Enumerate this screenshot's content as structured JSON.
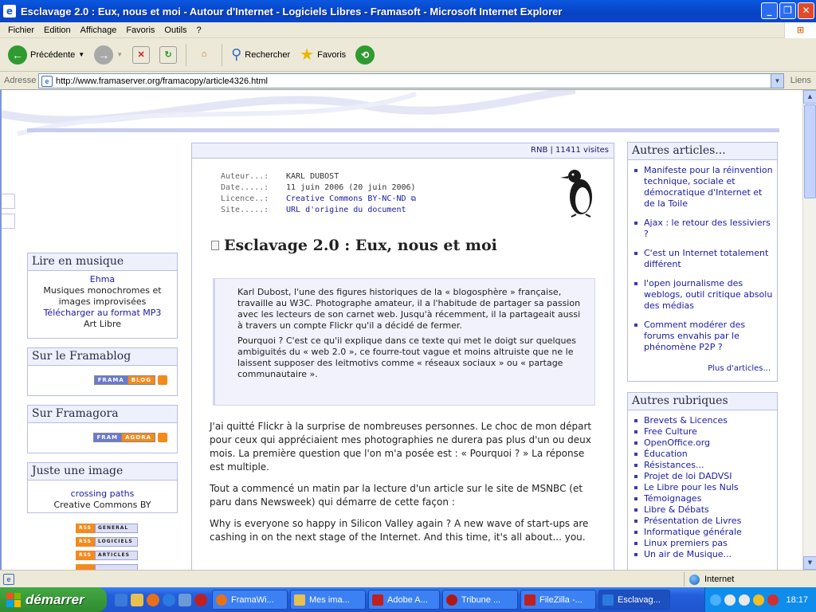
{
  "window": {
    "title": "Esclavage 2.0 : Eux, nous et moi - Autour d'Internet - Logiciels Libres - Framasoft - Microsoft Internet Explorer"
  },
  "menu": [
    "Fichier",
    "Edition",
    "Affichage",
    "Favoris",
    "Outils",
    "?"
  ],
  "toolbar": {
    "back": "Précédente",
    "search": "Rechercher",
    "favorites": "Favoris"
  },
  "address": {
    "label": "Adresse",
    "url": "http://www.framaserver.org/framacopy/article4326.html",
    "links": "Liens"
  },
  "page": {
    "stats": "RNB | 11411 visites",
    "meta": [
      {
        "label": "Auteur...:",
        "value": "KARL DUBOST"
      },
      {
        "label": "Date.....:",
        "value": "11 juin 2006 (20 juin 2006)"
      },
      {
        "label": "Licence..:",
        "value": "Creative Commons BY-NC-ND"
      },
      {
        "label": "Site.....:",
        "value": "URL d'origine du document"
      }
    ],
    "title": "Esclavage 2.0 : Eux, nous et moi",
    "chapo": [
      "Karl Dubost, l'une des figures historiques de la « blogosphère » française, travaille au W3C. Photographe amateur, il a l'habitude de partager sa passion avec les lecteurs de son carnet web. Jusqu'à récemment, il la partageait aussi à travers un compte Flickr qu'il a décidé de fermer.",
      "Pourquoi ? C'est ce qu'il explique dans ce texte qui met le doigt sur quelques ambiguités du « web 2.0 », ce fourre-tout vague et moins altruiste que ne le laissent supposer des leitmotivs comme « réseaux sociaux » ou « partage communautaire »."
    ],
    "body": [
      "J'ai quitté Flickr à la surprise de nombreuses personnes. Le choc de mon départ pour ceux qui appréciaient mes photographies ne durera pas plus d'un ou deux mois. La première question que l'on m'a posée est : « Pourquoi ? » La réponse est multiple.",
      "Tout a commencé un matin par la lecture d'un article sur le site de MSNBC (et paru dans Newsweek) qui démarre de cette façon :",
      "Why is everyone so happy in Silicon Valley again ? A new wave of start-ups are cashing in on the next stage of the Internet. And this time, it's all about... you."
    ]
  },
  "left": {
    "music": {
      "title": "Lire en musique",
      "artist": "Ehma",
      "desc": "Musiques monochromes et images improvisées",
      "mp3": "Télécharger au format MP3",
      "license": "Art Libre"
    },
    "blog": {
      "title": "Sur le Framablog",
      "b1": "FRAMA",
      "b2": "BLOG"
    },
    "agora": {
      "title": "Sur Framagora",
      "b1": "FRAM",
      "b2": "AGORA"
    },
    "image": {
      "title": "Juste une image",
      "name": "crossing paths",
      "license": "Creative Commons BY"
    },
    "rss": [
      {
        "tag": "RSS",
        "label": "GENERAL"
      },
      {
        "tag": "RSS",
        "label": "LOGICIELS"
      },
      {
        "tag": "RSS",
        "label": "ARTICLES"
      }
    ]
  },
  "right": {
    "articles": {
      "title": "Autres articles...",
      "items": [
        "Manifeste pour la réinvention technique, sociale et démocratique d'Internet et de la Toile",
        "Ajax : le retour des lessiviers ?",
        "C'est un Internet totalement différent",
        "l'open journalisme des weblogs, outil critique absolu des médias",
        "Comment modérer des forums envahis par le phénomène P2P ?"
      ],
      "more": "Plus d'articles..."
    },
    "rubriques": {
      "title": "Autres rubriques",
      "items": [
        "Brevets & Licences",
        "Free Culture",
        "OpenOffice.org",
        "Éducation",
        "Résistances...",
        "Projet de loi DADVSI",
        "Le Libre pour les Nuls",
        "Témoignages",
        "Libre & Débats",
        "Présentation de Livres",
        "Informatique générale",
        "Linux premiers pas",
        "Un air de Musique..."
      ]
    }
  },
  "status": {
    "zone": "Internet"
  },
  "taskbar": {
    "start": "démarrer",
    "tasks": [
      "FramaWi...",
      "Mes ima...",
      "Adobe A...",
      "Tribune ...",
      "FileZilla -...",
      "Esclavag..."
    ],
    "clock": "18:17"
  },
  "colors": {
    "accent": "#c8ccf0",
    "link": "#1a1aa6",
    "xp_blue": "#245edb"
  }
}
